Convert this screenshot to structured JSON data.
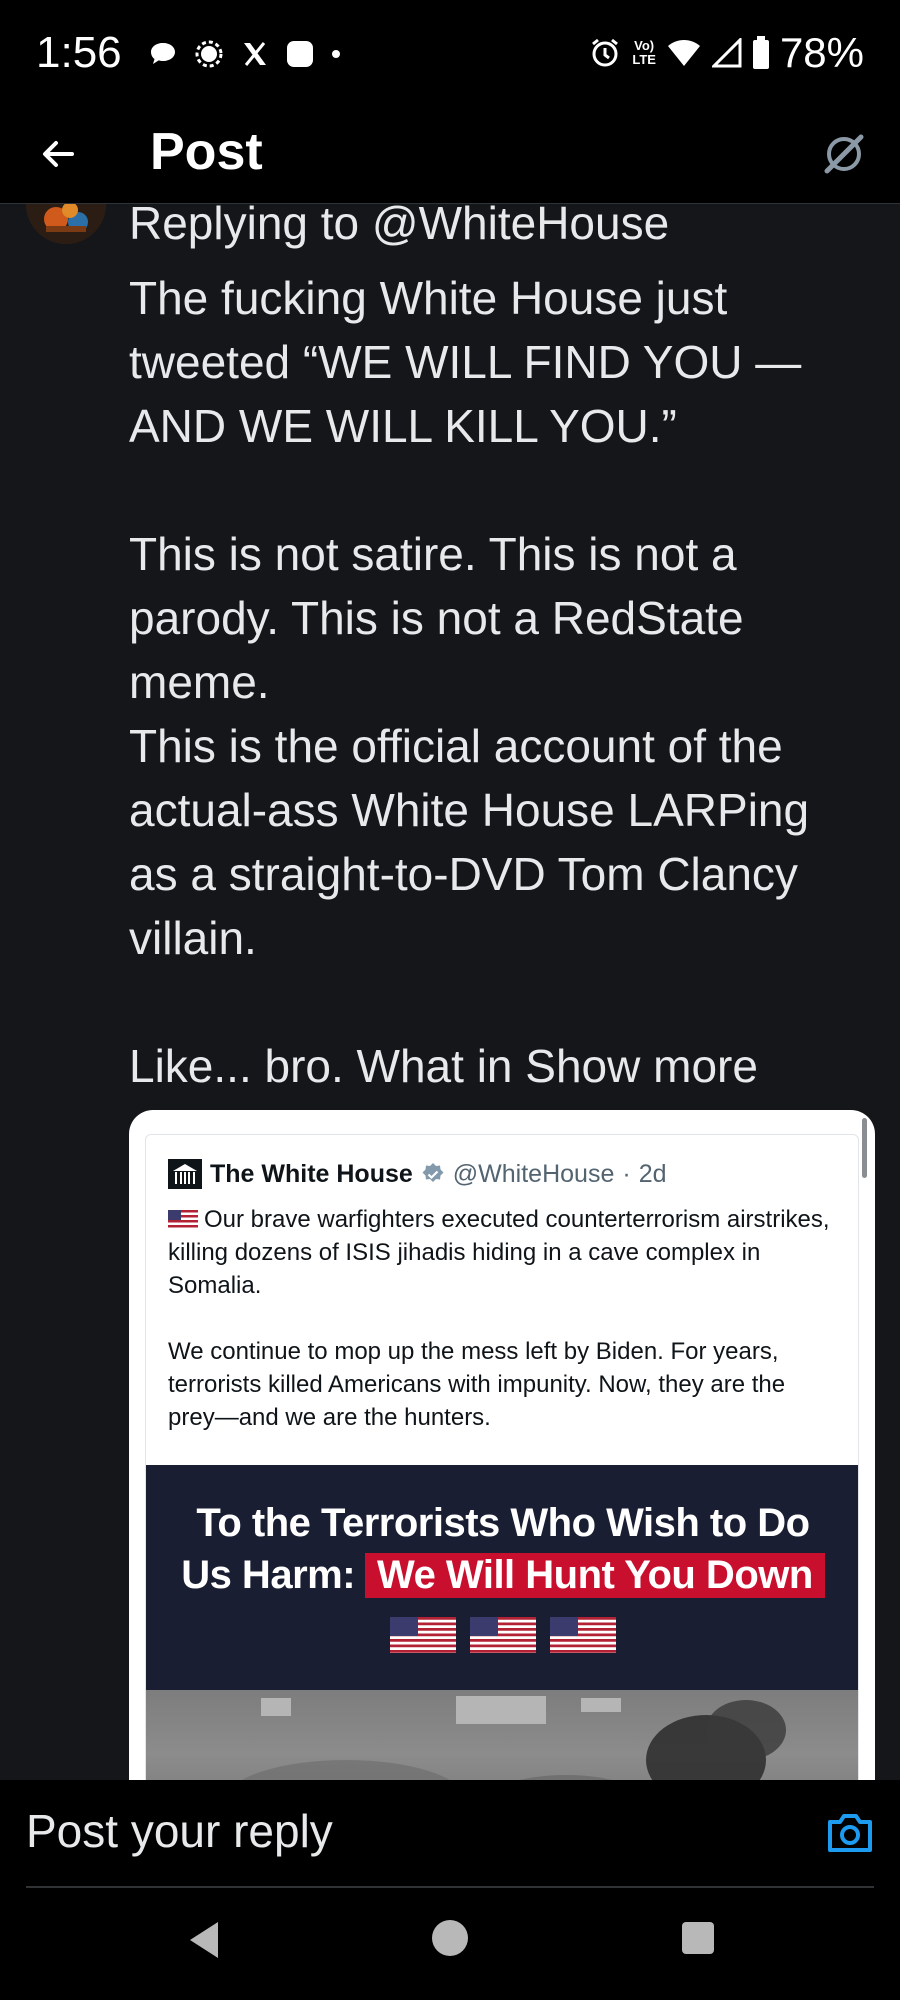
{
  "status_bar": {
    "time": "1:56",
    "network_label_top": "Vo)",
    "network_label_bottom": "LTE",
    "battery_percent": "78%",
    "left_icons": [
      "messages-icon",
      "signal-app-icon",
      "x-icon",
      "app-square-icon",
      "dot-icon"
    ],
    "right_icons": [
      "alarm-icon",
      "volte-icon",
      "wifi-icon",
      "cell-signal-icon",
      "battery-icon"
    ]
  },
  "header": {
    "title": "Post",
    "back_icon": "back-arrow-icon",
    "action_icon": "grok-icon"
  },
  "tweet": {
    "replying_to": "Replying to @WhiteHouse",
    "paragraphs": [
      "The fucking White House just tweeted “WE WILL FIND YOU — AND WE WILL KILL YOU.”",
      "",
      "This is not satire. This is not a parody. This is not a RedState meme.",
      "This is the official account of the actual-ass White House LARPing as a straight-to-DVD Tom Clancy villain.",
      ""
    ],
    "last_line": "Like... bro. What in",
    "show_more": "Show more"
  },
  "quoted_post": {
    "name": "The White House",
    "handle": "@WhiteHouse",
    "separator": "·",
    "age": "2d",
    "paragraphs": [
      "Our brave warfighters executed counterterrorism airstrikes, killing dozens of ISIS jihadis hiding in a cave complex in Somalia.",
      "",
      "We continue to mop up the mess left by Biden. For years, terrorists killed Americans with impunity. Now, they are the prey—and we are the hunters."
    ],
    "banner": {
      "line1": "To the Terrorists Who Wish to Do",
      "line2_prefix": "Us Harm:",
      "line2_highlight": "We Will Hunt You Down",
      "flag_count": 3
    }
  },
  "composer": {
    "placeholder": "Post your reply",
    "camera_icon": "camera-icon"
  },
  "nav": {
    "back": "nav-back-icon",
    "home": "nav-home-icon",
    "recents": "nav-recents-icon"
  },
  "colors": {
    "background": "#14161a",
    "bar_background": "#000000",
    "text": "#e7e9ea",
    "accent": "#1d9bf0",
    "banner_navy": "#1a1e33",
    "banner_red": "#c8102e"
  }
}
